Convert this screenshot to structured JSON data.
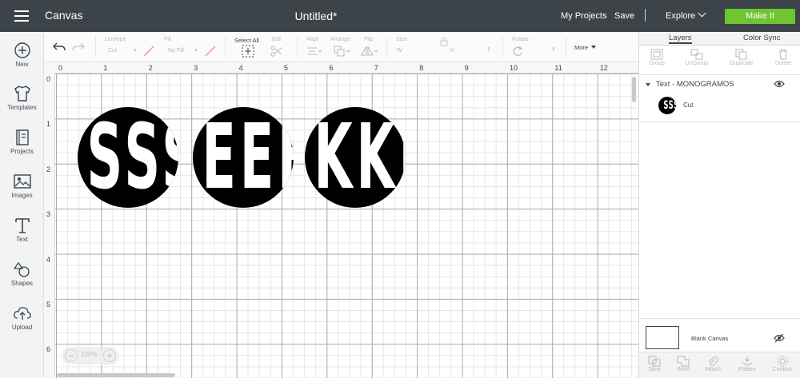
{
  "topbar": {
    "app_title": "Canvas",
    "doc_title": "Untitled*",
    "my_projects": "My Projects",
    "save": "Save",
    "explore": "Explore",
    "make_it": "Make It",
    "accent_color": "#6ec531"
  },
  "sidebar": {
    "items": [
      {
        "label": "New",
        "icon": "plus-circle-icon"
      },
      {
        "label": "Templates",
        "icon": "shirt-icon"
      },
      {
        "label": "Projects",
        "icon": "projects-icon"
      },
      {
        "label": "Images",
        "icon": "image-icon"
      },
      {
        "label": "Text",
        "icon": "text-icon"
      },
      {
        "label": "Shapes",
        "icon": "shapes-icon"
      },
      {
        "label": "Upload",
        "icon": "upload-icon"
      }
    ]
  },
  "toolbar": {
    "linetype_label": "Linetype",
    "linetype_value": "Cut",
    "fill_label": "Fill",
    "fill_value": "No Fill",
    "select_all": "Select All",
    "edit": "Edit",
    "align": "Align",
    "arrange": "Arrange",
    "flip": "Flip",
    "size": "Size",
    "size_w": "W",
    "size_h": "H",
    "rotate": "Rotate",
    "more": "More"
  },
  "canvas": {
    "ruler_top": [
      "0",
      "1",
      "2",
      "3",
      "4",
      "5",
      "6",
      "7",
      "8",
      "9",
      "10",
      "11",
      "12"
    ],
    "ruler_left": [
      "0",
      "1",
      "2",
      "3",
      "4",
      "5",
      "6"
    ],
    "monograms": [
      "SSS",
      "EEE",
      "KKK"
    ],
    "zoom": "100%",
    "zoom_minus": "−",
    "zoom_plus": "+"
  },
  "right_panel": {
    "tabs": [
      "Layers",
      "Color Sync"
    ],
    "tools": [
      "Group",
      "UnGroup",
      "Duplicate",
      "Delete"
    ],
    "layer_group_name": "Text - MONOGRAMOS",
    "layer_item": {
      "thumb": "SSS",
      "name": "Cut"
    },
    "blank_canvas": "Blank Canvas",
    "bottom_tools": [
      "Slice",
      "Weld",
      "Attach",
      "Flatten",
      "Contour"
    ]
  }
}
